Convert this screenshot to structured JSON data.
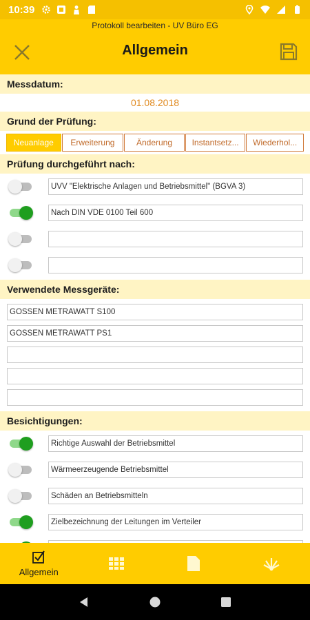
{
  "status": {
    "time": "10:39"
  },
  "header": {
    "subtitle": "Protokoll bearbeiten - UV Büro EG",
    "title": "Allgemein"
  },
  "messdatum": {
    "label": "Messdatum:",
    "value": "01.08.2018"
  },
  "grund": {
    "label": "Grund der Prüfung:",
    "tabs": [
      {
        "label": "Neuanlage",
        "selected": true
      },
      {
        "label": "Erweiterung",
        "selected": false
      },
      {
        "label": "Änderung",
        "selected": false
      },
      {
        "label": "Instantsetz...",
        "selected": false
      },
      {
        "label": "Wiederhol...",
        "selected": false
      }
    ]
  },
  "pruefung": {
    "label": "Prüfung durchgeführt nach:",
    "rows": [
      {
        "on": false,
        "value": "UVV \"Elektrische Anlagen und Betriebsmittel\" (BGVA 3)"
      },
      {
        "on": true,
        "value": "Nach DIN VDE 0100 Teil 600"
      },
      {
        "on": false,
        "value": ""
      },
      {
        "on": false,
        "value": ""
      }
    ]
  },
  "messgeraete": {
    "label": "Verwendete Messgeräte:",
    "fields": [
      "GOSSEN METRAWATT S100",
      "GOSSEN METRAWATT PS1",
      "",
      "",
      ""
    ]
  },
  "besichtigungen": {
    "label": "Besichtigungen:",
    "rows": [
      {
        "on": true,
        "value": "Richtige Auswahl der Betriebsmittel"
      },
      {
        "on": false,
        "value": "Wärmeerzeugende Betriebsmittel"
      },
      {
        "on": false,
        "value": "Schäden an Betriebsmitteln"
      },
      {
        "on": true,
        "value": "Zielbezeichnung der Leitungen im Verteiler"
      },
      {
        "on": true,
        "value": ""
      }
    ]
  },
  "bottom_nav": {
    "items": [
      {
        "label": "Allgemein",
        "icon": "checkbox-icon"
      },
      {
        "icon": "grid-icon"
      },
      {
        "icon": "document-icon"
      },
      {
        "icon": "measurement-icon"
      }
    ]
  },
  "colors": {
    "primary": "#ffcc00",
    "section_bg": "#fff4c4",
    "accent_orange": "#e08a20",
    "switch_on": "#1f9e1f"
  }
}
